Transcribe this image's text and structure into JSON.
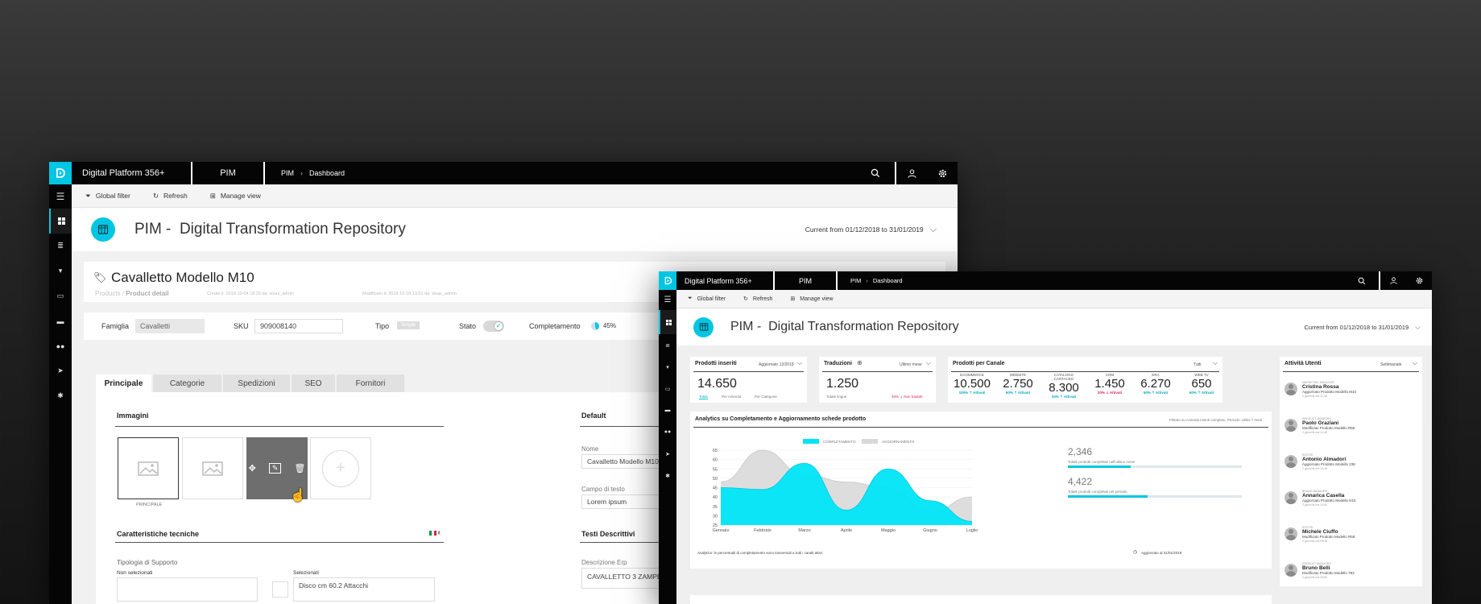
{
  "colors": {
    "accent": "#00c6e3",
    "topbar": "#050505",
    "negative": "#e0245e"
  },
  "app": {
    "platform": "Digital Platform 356+",
    "module": "PIM",
    "breadcrumb_root": "PIM",
    "breadcrumb_current": "Dashboard"
  },
  "filters": {
    "global": "Global filter",
    "refresh": "Refresh",
    "manage": "Manage view"
  },
  "header": {
    "prefix": "PIM -",
    "title": "Digital Transformation Repository",
    "range": "Current  from 01/12/2018 to 31/01/2019"
  },
  "product": {
    "title": "Cavalletto Modello M10",
    "crumb_root": "Products",
    "crumb_current": "Product detail",
    "created": "Creato il: 2018-10-04 18:26 da: sisas_admin",
    "modified": "Modificato il: 2018-10-18 13:51 da: sisas_admin",
    "famiglia_label": "Famiglia",
    "famiglia_value": "Cavalletti",
    "sku_label": "SKU",
    "sku_value": "909008140",
    "tipo_label": "Tipo",
    "tipo_value": "Simple",
    "stato_label": "Stato",
    "completamento_label": "Completamento",
    "completamento_value": "45%",
    "completamento_fraction": 0.45,
    "tabs": [
      "Principale",
      "Categorie",
      "Spedizioni",
      "SEO",
      "Fornitori"
    ],
    "images_title": "Immagini",
    "principale_caption": "PRINCIPALE",
    "tech_title": "Caratteristiche tecniche",
    "lang": "it",
    "support_label": "Tipologia di Supporto",
    "not_selected": "Non selezionati",
    "selected": "Selezionati",
    "selected_value": "Disco cm 60.2 Attacchi",
    "default_title": "Default",
    "nome_label": "Nome",
    "nome_value": "Cavalletto Modello M10",
    "testo_label": "Campo di testo",
    "testo_value": "Lorem ipsum",
    "desc_title": "Testi Descrittivi",
    "erp_label": "Descrizione Erp",
    "erp_value": "CAVALLETTO 3 ZAMPE M10 Dis 60 -"
  },
  "dashboard": {
    "prodotti": {
      "title": "Prodotti inseriti",
      "sub": "Aggiornato 12/2018",
      "value": "14.650",
      "tabs": [
        "Totali",
        "Per Azienda",
        "Per Categorie"
      ]
    },
    "traduzioni": {
      "title": "Traduzioni",
      "sub": "Ultimo mese",
      "value": "1.250",
      "caption": "Totale lingue",
      "delta": "40% ⇣ Non tradotti"
    },
    "canali": {
      "title": "Prodotti per Canale",
      "sub": "Tutti",
      "items": [
        {
          "name": "ECOMMERCE",
          "value": "10.500",
          "delta": "100% ⇡ Attivati",
          "neg": false
        },
        {
          "name": "WEBSITE",
          "value": "2.750",
          "delta": "60% ⇡ Attivati",
          "neg": false
        },
        {
          "name": "CATALOGO CARTACEO",
          "value": "8.300",
          "delta": "40% ⇡ Attivati",
          "neg": false
        },
        {
          "name": "CRM",
          "value": "1.450",
          "delta": "20% ⇣ Attivati",
          "neg": true
        },
        {
          "name": "ERA",
          "value": "6.270",
          "delta": "50% ⇡ Attivati",
          "neg": false
        },
        {
          "name": "WEB TV",
          "value": "650",
          "delta": "60% ⇡ Attivati",
          "neg": false
        }
      ]
    },
    "utenti": {
      "title": "Attività Utenti",
      "sub": "Settimanale",
      "items": [
        {
          "role": "MARKETING MANAGER",
          "name": "Cristina Rossa",
          "action": "Aggiornato Prodotto Modello M10",
          "time": "2 giorni fa ore 11:45"
        },
        {
          "role": "PRODUCT MANAGER",
          "name": "Paolo Graziani",
          "action": "Modificato Prodotto Modello R58",
          "time": "2 giorni fa ore 11:45"
        },
        {
          "role": "EDITOR",
          "name": "Antonio Almadori",
          "action": "Aggiornato Prodotto Modello 238",
          "time": "2 giorni fa ore 10:15"
        },
        {
          "role": "BRAND MANAGER",
          "name": "Annarica Casella",
          "action": "Aggiornato Prodotto Modello N15",
          "time": "2 giorni fa ore 10:00"
        },
        {
          "role": "EDITOR",
          "name": "Michele Ciuffo",
          "action": "Modificato Prodotto Modello R58",
          "time": "2 giorni fa ore 09:45"
        },
        {
          "role": "PRODUCT MANAGER",
          "name": "Bruno Belli",
          "action": "Modificato Prodotto Modello T82",
          "time": "2 giorni fa ore 09:00"
        }
      ]
    },
    "analytics": {
      "title": "Analytics su Completamento e Aggiornamento schede prodotto",
      "filter": "Filtrato su Azienda Utenti completo. Periodo: ultimi 7 mesi",
      "footer": "Analytics: le percentuali di completamento sono trasversali a tutti i canali attivi.",
      "updated": "Aggiornato al 31/01/2019",
      "stat1_value": "2,346",
      "stat1_label": "Totale prodotti completati nell'ultimo mese",
      "stat1_fraction": 0.36,
      "stat2_value": "4,422",
      "stat2_label": "Totale prodotti completati nel periodo",
      "stat2_fraction": 0.46
    }
  },
  "chart_data": {
    "type": "area",
    "x": [
      "Gennaio",
      "Febbraio",
      "Marzo",
      "Aprile",
      "Maggio",
      "Giugno",
      "Luglio"
    ],
    "series": [
      {
        "name": "COMPLETAMENTO",
        "color": "#00e5f5",
        "values": [
          45,
          44,
          58,
          33,
          55,
          38,
          27
        ]
      },
      {
        "name": "AGGIORNAMENTO",
        "color": "#d9d9d9",
        "values": [
          48,
          65,
          52,
          48,
          45,
          32,
          40
        ]
      }
    ],
    "ylim": [
      25,
      65
    ],
    "yticks": [
      65,
      60,
      55,
      50,
      45,
      40,
      35,
      30,
      25
    ],
    "legend": "top"
  }
}
